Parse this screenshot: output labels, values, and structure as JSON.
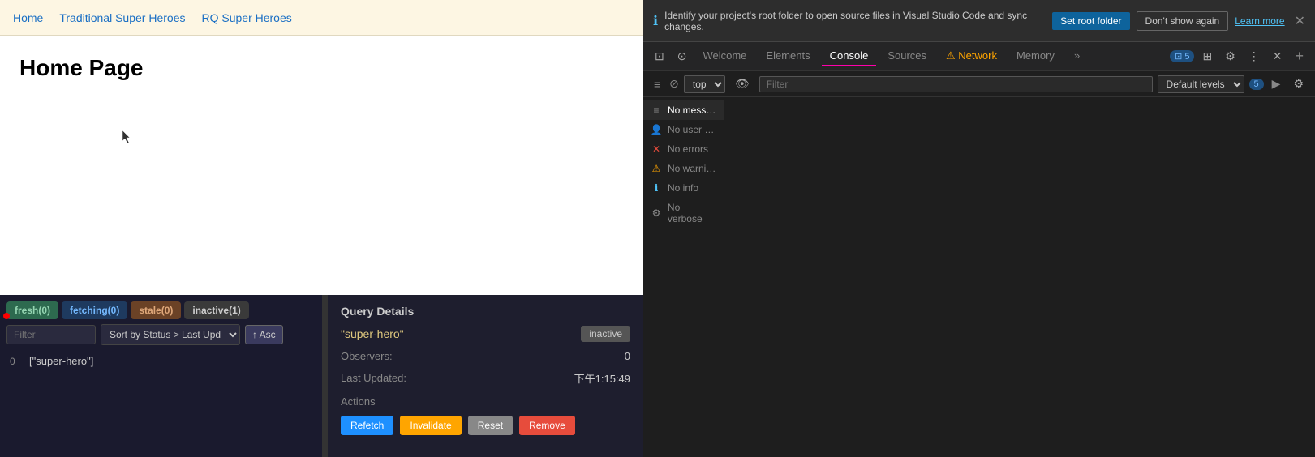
{
  "app": {
    "nav": {
      "home_label": "Home",
      "trad_label": "Traditional Super Heroes",
      "rq_label": "RQ Super Heroes"
    },
    "page_title": "Home Page"
  },
  "rq_devtools": {
    "tabs": {
      "fresh": "fresh(0)",
      "fetching": "fetching(0)",
      "stale": "stale(0)",
      "inactive": "inactive(1)"
    },
    "filter_placeholder": "Filter",
    "sort_label": "Sort by Status > Last Upd",
    "asc_label": "↑ Asc",
    "query_item": {
      "observers": "0",
      "key": "[\"super-hero\"]"
    },
    "details": {
      "title": "Query Details",
      "query_key": "\"super-hero\"",
      "status": "inactive",
      "observers_label": "Observers:",
      "observers_value": "0",
      "last_updated_label": "Last Updated:",
      "last_updated_value": "下午1:15:49",
      "actions_label": "Actions",
      "btn_refetch": "Refetch",
      "btn_invalidate": "Invalidate",
      "btn_reset": "Reset",
      "btn_remove": "Remove"
    }
  },
  "devtools": {
    "vscode_banner": {
      "message": "Identify your project's root folder to open source files in Visual Studio Code and sync changes.",
      "btn_set_root": "Set root folder",
      "btn_dont_show": "Don't show again",
      "btn_learn_more": "Learn more"
    },
    "toolbar": {
      "tabs": [
        "Welcome",
        "Elements",
        "Console",
        "Sources",
        "Network",
        "Memory"
      ],
      "active_tab": "Console",
      "network_tab": "Network",
      "badge_count": "5",
      "plus_label": "+"
    },
    "console": {
      "context": "top",
      "filter_placeholder": "Filter",
      "levels_label": "Default levels",
      "badge": "5",
      "sidebar": {
        "items": [
          {
            "icon": "≡",
            "label": "No mess…",
            "icon_class": "icon-list"
          },
          {
            "icon": "👤",
            "label": "No user …",
            "icon_class": "icon-user"
          },
          {
            "icon": "✕",
            "label": "No errors",
            "icon_class": "icon-error"
          },
          {
            "icon": "⚠",
            "label": "No warni…",
            "icon_class": "icon-warning"
          },
          {
            "icon": "ℹ",
            "label": "No info",
            "icon_class": "icon-info"
          },
          {
            "icon": "⚙",
            "label": "No verbose",
            "icon_class": "icon-verbose"
          }
        ]
      }
    }
  }
}
